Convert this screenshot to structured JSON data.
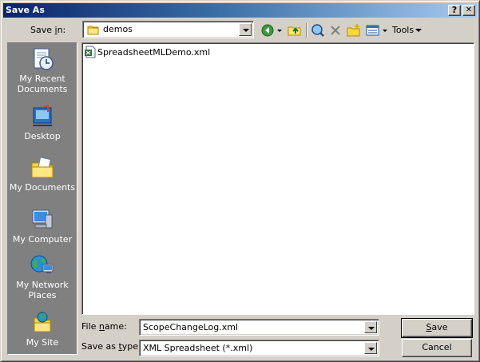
{
  "window": {
    "title": "Save As"
  },
  "title_buttons": {
    "help": "?",
    "close": "✕"
  },
  "save_in": {
    "label_pre": "Save ",
    "label_access": "i",
    "label_post": "n:",
    "value": "demos",
    "icon": "folder-icon"
  },
  "toolbar": {
    "back_icon": "back-icon",
    "up_icon": "up-folder-icon",
    "search_icon": "search-web-icon",
    "delete_icon": "delete-icon",
    "new_folder_icon": "new-folder-icon",
    "views_icon": "views-icon",
    "tools_label": "Tools"
  },
  "places": [
    {
      "line1": "My Recent",
      "line2": "Documents",
      "icon": "recent-documents-icon"
    },
    {
      "line1": "Desktop",
      "line2": "",
      "icon": "desktop-icon"
    },
    {
      "line1": "My Documents",
      "line2": "",
      "icon": "my-documents-icon"
    },
    {
      "line1": "My Computer",
      "line2": "",
      "icon": "my-computer-icon"
    },
    {
      "line1": "My Network",
      "line2": "Places",
      "icon": "network-places-icon"
    },
    {
      "line1": "My Site",
      "line2": "",
      "icon": "my-site-icon"
    }
  ],
  "files": [
    {
      "name": "SpreadsheetMLDemo.xml",
      "icon": "xml-spreadsheet-icon"
    }
  ],
  "filename": {
    "label_pre": "File ",
    "label_access": "n",
    "label_post": "ame:",
    "value": "ScopeChangeLog.xml"
  },
  "filetype": {
    "label_pre": "Save as ",
    "label_access": "t",
    "label_post": "ype:",
    "value": "XML Spreadsheet (*.xml)"
  },
  "buttons": {
    "save_access": "S",
    "save_rest": "ave",
    "cancel": "Cancel"
  }
}
